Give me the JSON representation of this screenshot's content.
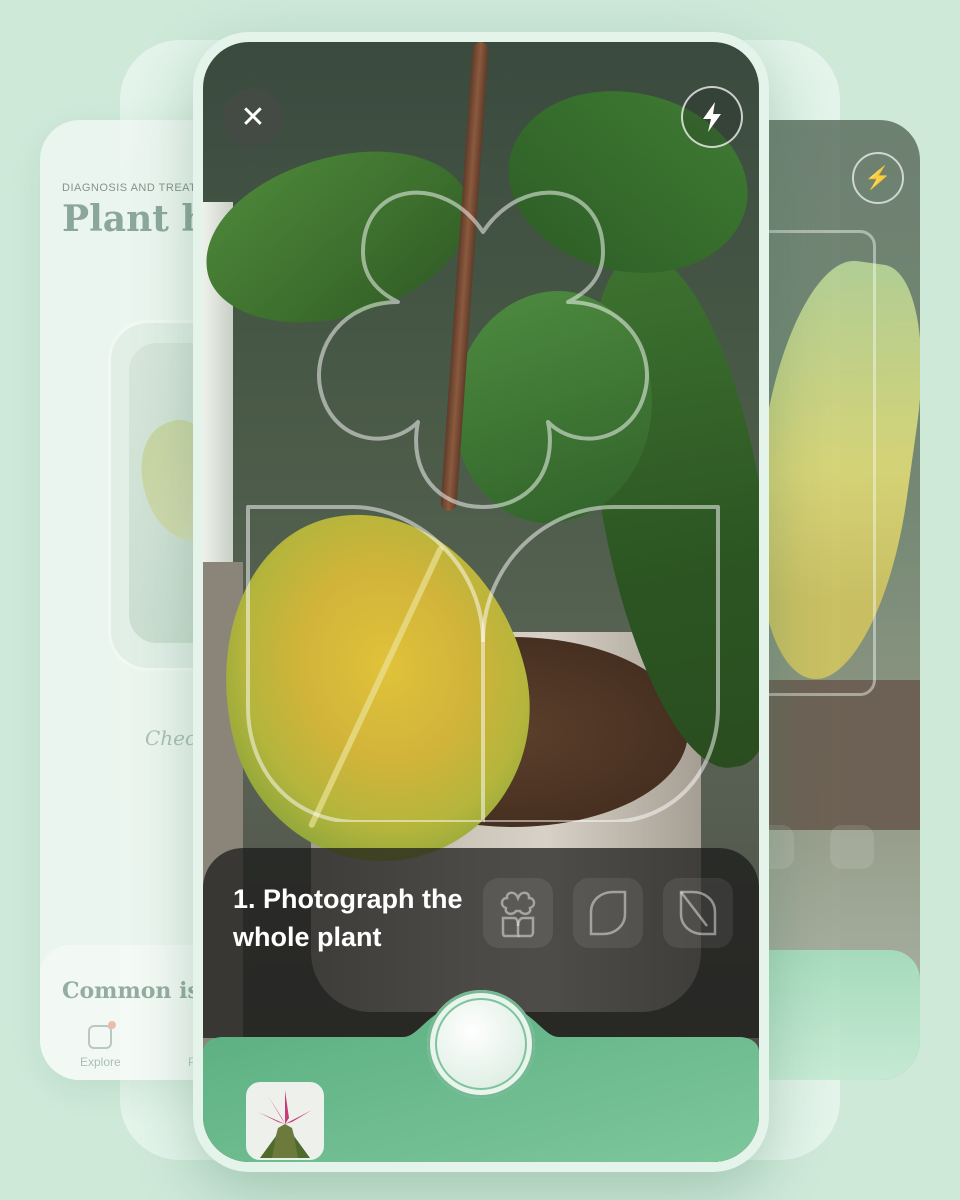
{
  "left_screen": {
    "kicker": "DIAGNOSIS AND TREATM",
    "title": "Plant he",
    "check_text": "Chec",
    "common_issues": "Common iss",
    "tab_explore": "Explore",
    "tab_second": "P"
  },
  "camera": {
    "close_icon": "close-icon",
    "flash_icon": "flash-icon",
    "instruction": "1. Photograph the whole plant",
    "steps": [
      {
        "name": "whole-plant-step-icon"
      },
      {
        "name": "leaf-front-step-icon"
      },
      {
        "name": "leaf-back-step-icon"
      }
    ],
    "accent": "#6ebd8f",
    "panel_color": "#5fb585"
  }
}
